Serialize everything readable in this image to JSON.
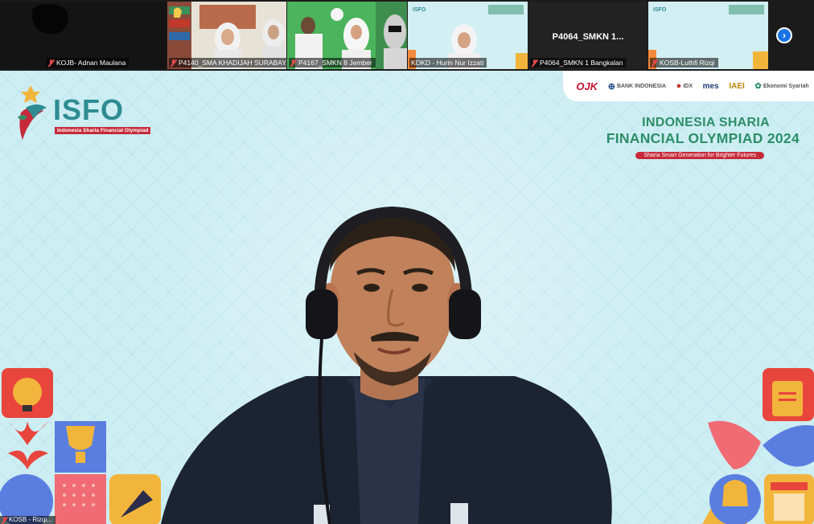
{
  "participants": [
    {
      "name": "KOJB- Adnan Maulana",
      "muted": true
    },
    {
      "name": "P4140_SMA KHADIJAH SURABAYA",
      "muted": true
    },
    {
      "name": "P4167_SMKN 8 Jember",
      "muted": true
    },
    {
      "name": "KOKD - Hurin Nur Izzati",
      "muted": false
    },
    {
      "name": "P4064_SMKN 1 Bangkalan",
      "muted": true,
      "display_name": "P4064_SMKN 1..."
    },
    {
      "name": "KOSB-Luthfi Rizqi",
      "muted": true
    }
  ],
  "next_page_icon": "chevron-right-icon",
  "sponsors": [
    "OJK",
    "BANK INDONESIA",
    "IDX",
    "mes",
    "IAEI",
    "Ekonomi Syariah"
  ],
  "logo": {
    "word": "ISFO",
    "subtitle": "Indonesia Sharia Financial Olympiad"
  },
  "event": {
    "line1": "INDONESIA SHARIA",
    "line2": "FINANCIAL OLYMPIAD 2024",
    "tagline": "Sharia Smart Generation for Brighter Futures"
  },
  "self_view_caption": "KOSB - Rizqi...",
  "colors": {
    "brand_teal": "#2e8c92",
    "brand_green": "#2d8e68",
    "brand_red": "#c62a3a",
    "background": "#cdeef3",
    "zoom_blue": "#1a73e8"
  }
}
